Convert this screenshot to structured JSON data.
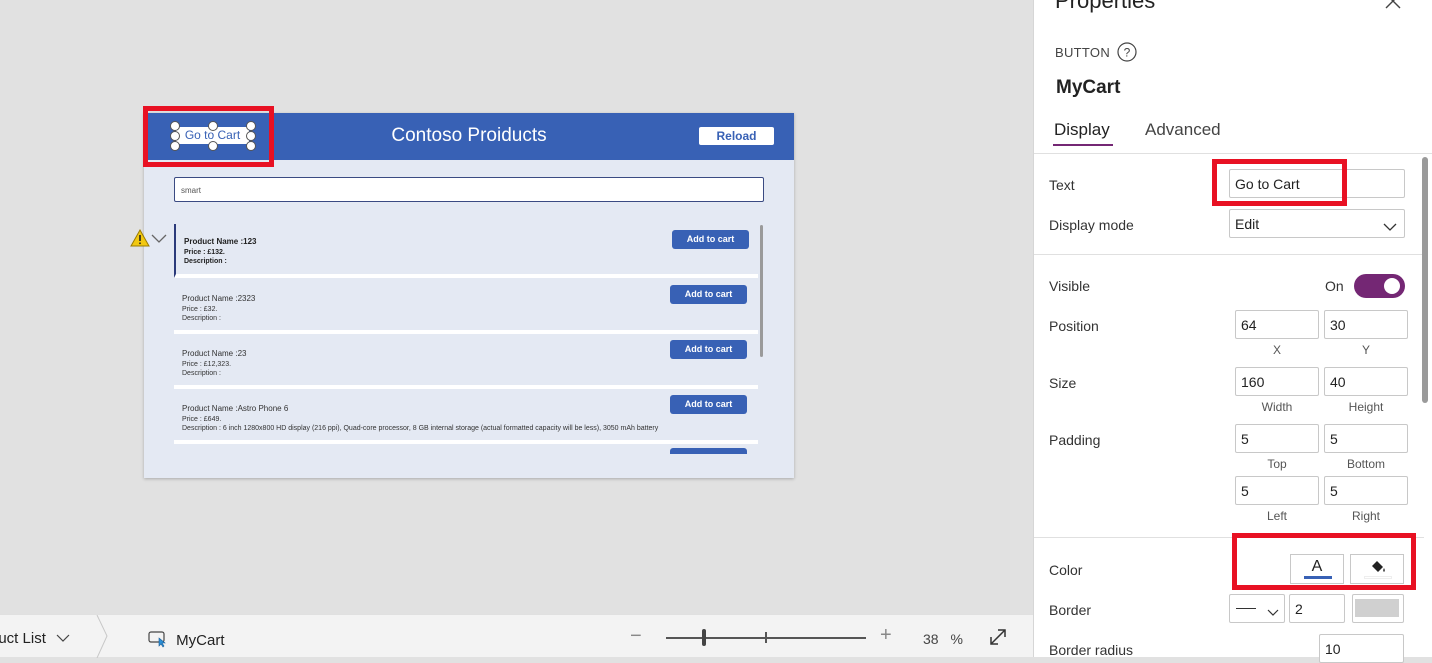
{
  "canvas_app": {
    "title": "Contoso Proiducts",
    "goto_button": "Go to Cart",
    "reload_button": "Reload",
    "search_value": "smart",
    "products": [
      {
        "name": "Product Name :123",
        "price": "Price :  £132.",
        "description": "Description  :",
        "button": "Add to cart"
      },
      {
        "name": "Product Name :2323",
        "price": "Price :  £32.",
        "description": "Description  :",
        "button": "Add to cart"
      },
      {
        "name": "Product Name :23",
        "price": "Price :  £12,323.",
        "description": "Description  :",
        "button": "Add to cart"
      },
      {
        "name": "Product Name :Astro Phone 6",
        "price": "Price :  £649.",
        "description": "Description  :  6 inch 1280x800 HD display (216 ppi), Quad-core processor, 8 GB internal storage (actual formatted capacity will be less), 3050 mAh battery",
        "button": "Add to cart"
      }
    ]
  },
  "bottombar": {
    "screen_crumb": "duct List",
    "control_crumb": "MyCart",
    "zoom": "38",
    "zoom_unit": "%"
  },
  "properties": {
    "title": "Properties",
    "control_type": "BUTTON",
    "control_name": "MyCart",
    "tabs": [
      "Display",
      "Advanced"
    ],
    "text_label": "Text",
    "text_value": "Go to Cart",
    "display_mode_label": "Display mode",
    "display_mode_value": "Edit",
    "visible_label": "Visible",
    "visible_value": "On",
    "position_label": "Position",
    "position_x": "64",
    "position_y": "30",
    "x_label": "X",
    "y_label": "Y",
    "size_label": "Size",
    "width": "160",
    "height": "40",
    "width_label": "Width",
    "height_label": "Height",
    "padding_label": "Padding",
    "padding_top": "5",
    "padding_bottom": "5",
    "padding_left": "5",
    "padding_right": "5",
    "top_label": "Top",
    "bottom_label": "Bottom",
    "left_label": "Left",
    "right_label": "Right",
    "color_label": "Color",
    "color_text_glyph": "A",
    "border_label": "Border",
    "border_width": "2",
    "border_radius_label": "Border radius",
    "border_radius_value": "10"
  },
  "colors": {
    "accent": "#742774",
    "app_header": "#3861b5",
    "highlight": "#e81123"
  }
}
